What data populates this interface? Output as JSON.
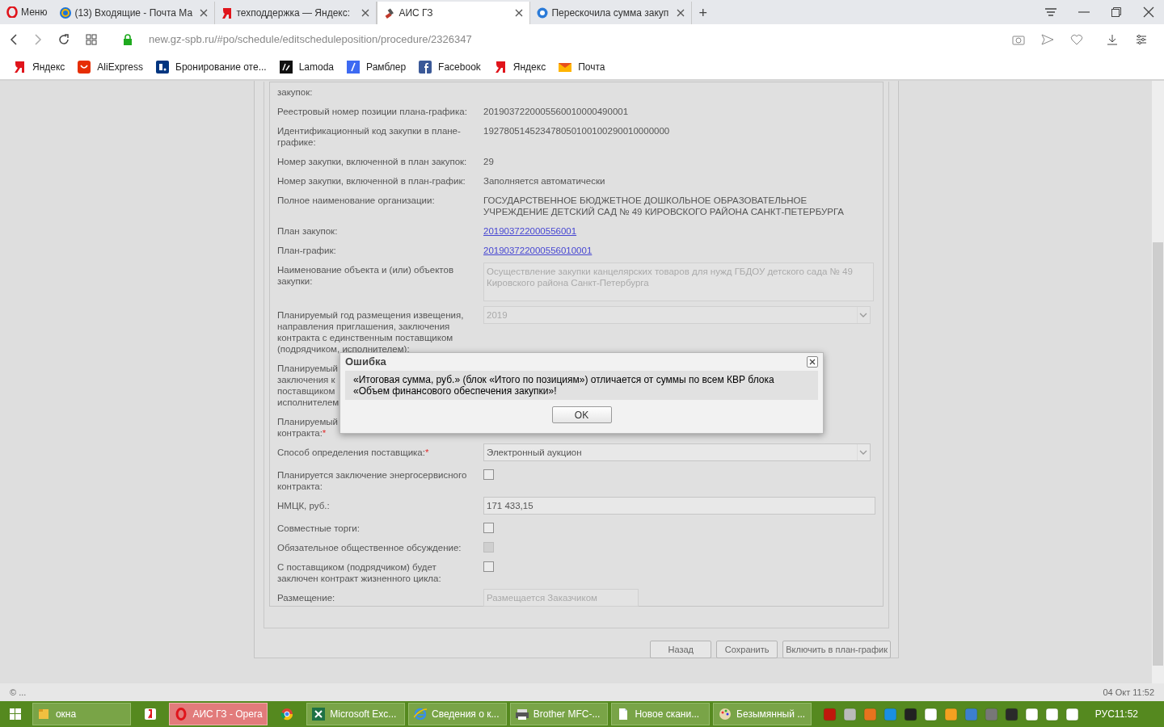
{
  "browser": {
    "menu": "Меню",
    "tabs": [
      {
        "title": "(13) Входящие - Почта Ма",
        "selected": false
      },
      {
        "title": "техподдержка — Яндекс:",
        "selected": false
      },
      {
        "title": "АИС ГЗ",
        "selected": true
      },
      {
        "title": "Перескочила сумма закуп",
        "selected": false
      }
    ],
    "new_tab": "+",
    "url": "new.gz-spb.ru/#po/schedule/editscheduleposition/procedure/2326347",
    "bookmarks": [
      "Яндекс",
      "AliExpress",
      "Бронирование оте...",
      "Lamoda",
      "Рамблер",
      "Facebook",
      "Яндекс",
      "Почта"
    ]
  },
  "form": {
    "rows": [
      {
        "label": "закупок:",
        "kind": "none"
      },
      {
        "label": "Реестровый номер позиции плана-графика:",
        "kind": "text",
        "value": "2019037220005560010000490001"
      },
      {
        "label": "Идентификационный код закупки в плане-графике:",
        "kind": "text",
        "value": "192780514523478050100100290010000000"
      },
      {
        "label": "Номер закупки, включенной в план закупок:",
        "kind": "text",
        "value": "29"
      },
      {
        "label": "Номер закупки, включенной в план-график:",
        "kind": "text",
        "value": "Заполняется автоматически"
      },
      {
        "label": "Полное наименование организации:",
        "kind": "text",
        "value": "ГОСУДАРСТВЕННОЕ БЮДЖЕТНОЕ ДОШКОЛЬНОЕ ОБРАЗОВАТЕЛЬНОЕ УЧРЕЖДЕНИЕ ДЕТСКИЙ САД № 49 КИРОВСКОГО РАЙОНА САНКТ-ПЕТЕРБУРГА"
      },
      {
        "label": "План закупок:",
        "kind": "link",
        "value": "201903722000556001"
      },
      {
        "label": "План-график:",
        "kind": "link",
        "value": "201903722000556010001"
      },
      {
        "label": "Наименование объекта и (или) объектов закупки:",
        "kind": "textarea",
        "value": "Осуществление закупки канцелярских товаров для нужд ГБДОУ детского сада № 49 Кировского района Санкт-Петербурга",
        "disabled": true
      },
      {
        "label": "Планируемый год размещения извещения, направления приглашения, заключения контракта с единственным поставщиком (подрядчиком, исполнителем):",
        "kind": "select",
        "value": "2019",
        "disabled": true
      },
      {
        "label": "Планируемый\nзаключения к\nпоставщиком\nисполнителем",
        "kind": "none"
      },
      {
        "label": "Планируемый\nконтракта:",
        "kind": "none",
        "required": true
      },
      {
        "label": "Способ определения поставщика:",
        "kind": "select",
        "value": "Электронный аукцион",
        "disabled": false,
        "required": true
      },
      {
        "label": "Планируется заключение энергосервисного контракта:",
        "kind": "checkbox",
        "checked": false,
        "disabled": false
      },
      {
        "label": "НМЦК, руб.:",
        "kind": "input",
        "value": "171 433,15",
        "disabled": false
      },
      {
        "label": "Совместные торги:",
        "kind": "checkbox",
        "checked": false,
        "disabled": false
      },
      {
        "label": "Обязательное общественное обсуждение:",
        "kind": "checkbox",
        "checked": false,
        "disabled": true
      },
      {
        "label": "С поставщиком (подрядчиком) будет заключен контракт жизненного цикла:",
        "kind": "checkbox",
        "checked": false,
        "disabled": false
      },
      {
        "label": "Размещение:",
        "kind": "input",
        "value": "Размещается Заказчиком",
        "disabled": true
      }
    ],
    "required_mark": "*",
    "buttons": [
      "Назад",
      "Сохранить",
      "Включить в план-график"
    ]
  },
  "dialog": {
    "title": "Ошибка",
    "message": "«Итоговая сумма, руб.» (блок «Итого по позициям») отличается от суммы по всем КВР блока «Объем финансового обеспечения закупки»!",
    "ok": "OK"
  },
  "status": {
    "left": "© ...",
    "right": "04 Окт 11:52"
  },
  "taskbar": {
    "items": [
      {
        "kind": "button",
        "label": "окна",
        "selected": false
      },
      {
        "kind": "icon",
        "selected": false
      },
      {
        "kind": "button",
        "label": "АИС ГЗ - Opera",
        "selected": true
      },
      {
        "kind": "icon",
        "selected": false
      },
      {
        "kind": "button",
        "label": "Microsoft Exc...",
        "selected": false
      },
      {
        "kind": "button",
        "label": "Сведения о к...",
        "selected": false
      },
      {
        "kind": "button",
        "label": "Brother MFC-...",
        "selected": false
      },
      {
        "kind": "button",
        "label": "Новое скани...",
        "selected": false
      },
      {
        "kind": "button",
        "label": "Безымянный ...",
        "selected": false
      }
    ],
    "language": "РУС",
    "clock": "11:52"
  }
}
